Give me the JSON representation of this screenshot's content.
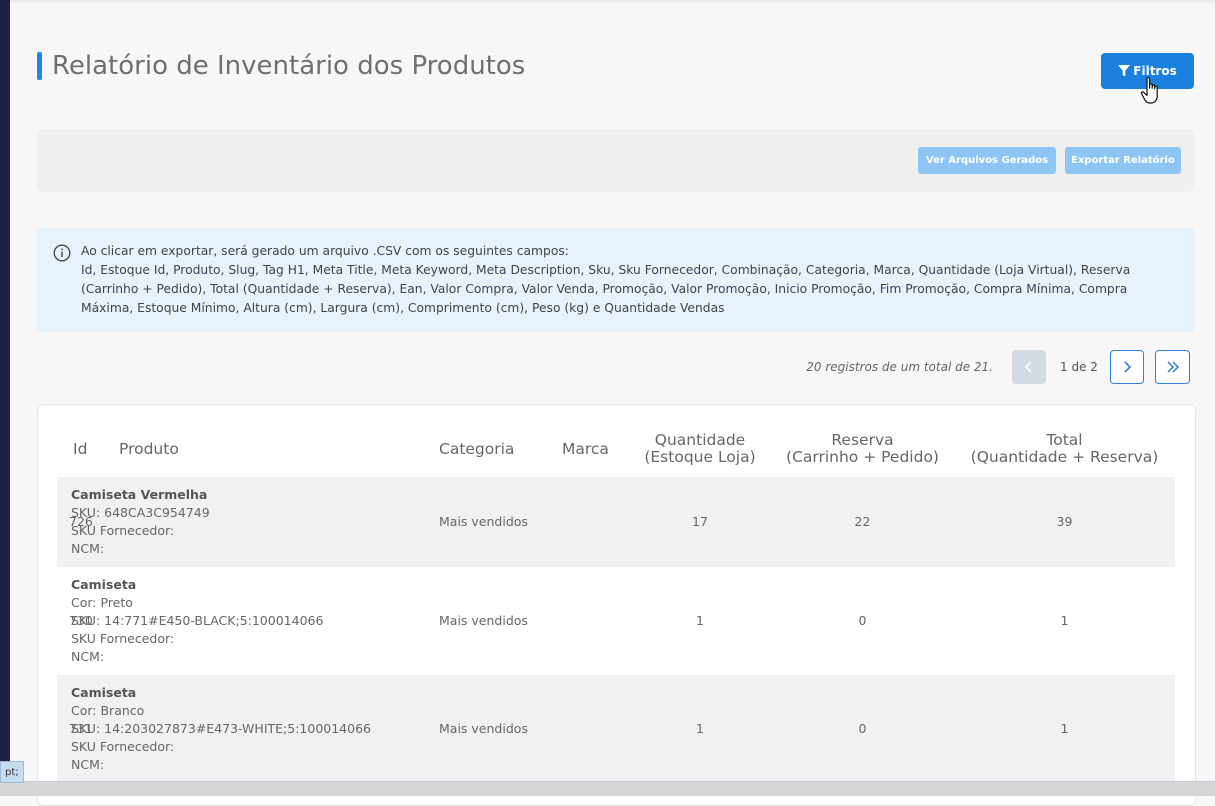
{
  "page": {
    "title": "Relatório de Inventário dos Produtos"
  },
  "toolbar": {
    "filters_label": "Filtros",
    "view_files_label": "Ver Arquivos Gerados",
    "export_label": "Exportar Relatório"
  },
  "info": {
    "line1": "Ao clicar em exportar, será gerado um arquivo .CSV com os seguintes campos:",
    "line2": "Id, Estoque Id, Produto, Slug, Tag H1, Meta Title, Meta Keyword, Meta Description, Sku, Sku Fornecedor, Combinação, Categoria, Marca, Quantidade (Loja Virtual), Reserva (Carrinho + Pedido), Total (Quantidade + Reserva), Ean, Valor Compra, Valor Venda, Promoção, Valor Promoção, Inicio Promoção, Fim Promoção, Compra Mínima, Compra Máxima, Estoque Mínimo, Altura (cm), Largura (cm), Comprimento (cm), Peso (kg) e Quantidade Vendas"
  },
  "pagination": {
    "summary": "20 registros de um total de 21.",
    "page_label": "1 de 2"
  },
  "table": {
    "headers": {
      "id": "Id",
      "produto": "Produto",
      "categoria": "Categoria",
      "marca": "Marca",
      "quantidade_1": "Quantidade",
      "quantidade_2": "(Estoque Loja)",
      "reserva_1": "Reserva",
      "reserva_2": "(Carrinho + Pedido)",
      "total_1": "Total",
      "total_2": "(Quantidade + Reserva)"
    },
    "rows": [
      {
        "id": "726",
        "name": "Camiseta Vermelha",
        "cor": "",
        "sku": "SKU: 648CA3C954749",
        "sku_fornecedor": "SKU Fornecedor:",
        "ncm": "NCM:",
        "categoria": "Mais vendidos",
        "marca": "",
        "quantidade": "17",
        "reserva": "22",
        "total": "39"
      },
      {
        "id": "730",
        "name": "Camiseta",
        "cor": "Cor: Preto",
        "sku": "SKU: 14:771#E450-BLACK;5:100014066",
        "sku_fornecedor": "SKU Fornecedor:",
        "ncm": "NCM:",
        "categoria": "Mais vendidos",
        "marca": "",
        "quantidade": "1",
        "reserva": "0",
        "total": "1"
      },
      {
        "id": "731",
        "name": "Camiseta",
        "cor": "Cor: Branco",
        "sku": "SKU: 14:203027873#E473-WHITE;5:100014066",
        "sku_fornecedor": "SKU Fornecedor:",
        "ncm": "NCM:",
        "categoria": "Mais vendidos",
        "marca": "",
        "quantidade": "1",
        "reserva": "0",
        "total": "1"
      }
    ]
  },
  "tooltip": "pt;",
  "colors": {
    "primary": "#1b7fe0",
    "light_button": "#8ec5f5",
    "info_bg": "#e7f2fd",
    "sidebar": "#1e2247"
  },
  "icons": {
    "filter": "filter-icon",
    "info": "info-icon",
    "prev": "chevron-left-icon",
    "next": "chevron-right-icon",
    "last": "double-chevron-right-icon",
    "cursor": "hand-cursor-icon"
  }
}
